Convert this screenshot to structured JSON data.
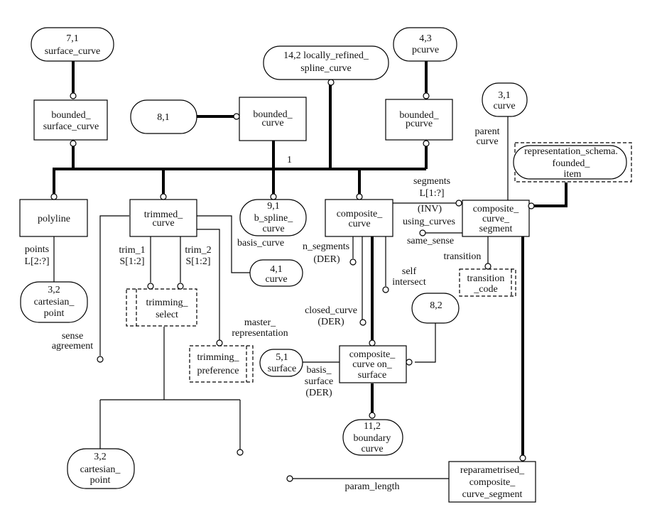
{
  "diagram": {
    "type": "EXPRESS-G",
    "entities": {
      "bounded_surface_curve": [
        "bounded_",
        "surface_curve"
      ],
      "bounded_curve": [
        "bounded_",
        "curve"
      ],
      "bounded_pcurve": [
        "bounded_",
        "pcurve"
      ],
      "polyline": [
        "polyline"
      ],
      "trimmed_curve": [
        "trimmed_",
        "curve"
      ],
      "composite_curve": [
        "composite_",
        "curve"
      ],
      "composite_curve_segment": [
        "composite_",
        "curve_",
        "segment"
      ],
      "composite_curve_on_surface": [
        "composite_",
        "curve on_",
        "surface"
      ],
      "reparametrised_composite_curve_segment": [
        "reparametrised_",
        "composite_",
        "curve_segment"
      ]
    },
    "types": {
      "trimming_select": [
        "trimming_",
        "select"
      ],
      "trimming_preference": [
        "trimming_",
        "preference"
      ],
      "transition_code": [
        "transition",
        "_code"
      ],
      "founded_item": [
        "representation_schema.",
        "founded_",
        "item"
      ]
    },
    "page_refs": {
      "surface_curve": [
        "7,1",
        "surface_curve"
      ],
      "ref_8_1": [
        "8,1"
      ],
      "locally_refined_spline_curve": [
        "14,2 locally_refined_",
        "spline_curve"
      ],
      "pcurve": [
        "4,3",
        "pcurve"
      ],
      "curve_3_1": [
        "3,1",
        "curve"
      ],
      "cartesian_point_a": [
        "3,2",
        "cartesian_",
        "point"
      ],
      "b_spline_curve": [
        "9,1",
        "b_spline_",
        "curve"
      ],
      "curve_4_1": [
        "4,1",
        "curve"
      ],
      "ref_8_2": [
        "8,2"
      ],
      "surface_5_1": [
        "5,1",
        "surface"
      ],
      "boundary_curve": [
        "11,2",
        "boundary",
        "curve"
      ],
      "cartesian_point_b": [
        "3,2",
        "cartesian_",
        "point"
      ]
    },
    "labels": {
      "oneof": "1",
      "points": [
        "points",
        "L[2:?]"
      ],
      "trim_1": [
        "trim_1",
        "S[1:2]"
      ],
      "trim_2": [
        "trim_2",
        "S[1:2]"
      ],
      "basis_curve": "basis_curve",
      "sense_agreement": [
        "sense",
        "agreement"
      ],
      "master_representation": [
        "master_",
        "representation"
      ],
      "n_segments": [
        "n_segments",
        "(DER)"
      ],
      "closed_curve": [
        "closed_curve",
        "(DER)"
      ],
      "self_intersect": [
        "self",
        "intersect"
      ],
      "segments": [
        "segments",
        "L[1:?]",
        "(INV)",
        "using_curves"
      ],
      "same_sense": "same_sense",
      "transition": "transition",
      "parent_curve": [
        "parent",
        "curve"
      ],
      "basis_surface": [
        "basis_",
        "surface",
        "(DER)"
      ],
      "param_length": "param_length"
    }
  }
}
